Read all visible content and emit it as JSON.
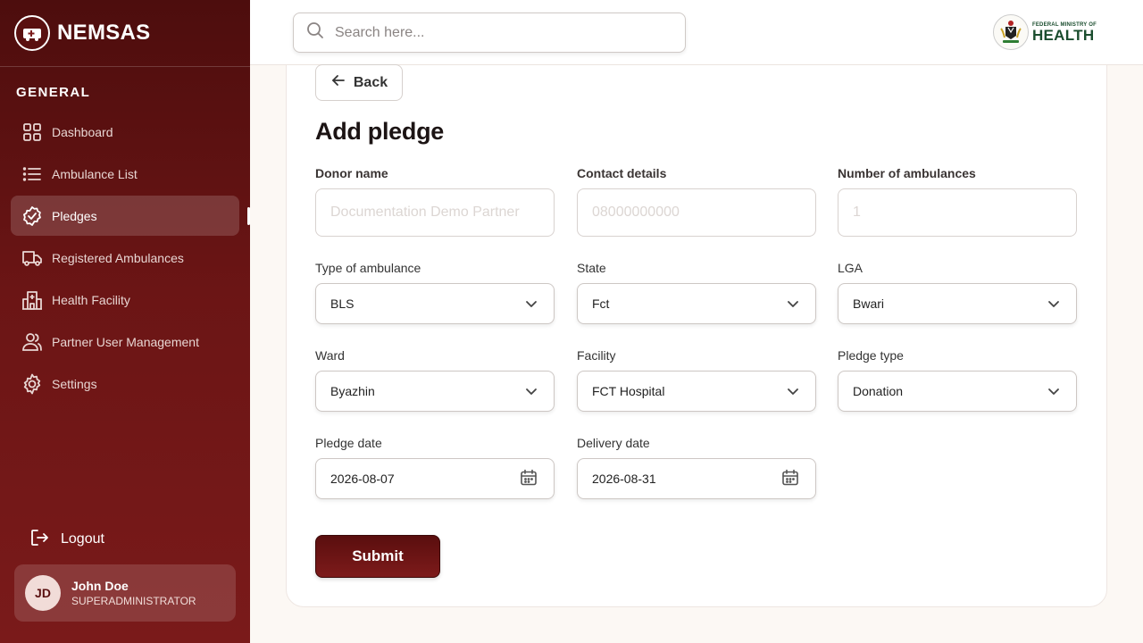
{
  "app": {
    "name": "NEMSAS",
    "logo_icon": "ambulance-logo-icon"
  },
  "sidebar": {
    "section_label": "GENERAL",
    "items": [
      {
        "label": "Dashboard",
        "icon": "grid-icon",
        "active": false
      },
      {
        "label": "Ambulance List",
        "icon": "list-icon",
        "active": false
      },
      {
        "label": "Pledges",
        "icon": "badge-check-icon",
        "active": true
      },
      {
        "label": "Registered Ambulances",
        "icon": "truck-icon",
        "active": false
      },
      {
        "label": "Health Facility",
        "icon": "hospital-icon",
        "active": false
      },
      {
        "label": "Partner User Management",
        "icon": "users-icon",
        "active": false
      },
      {
        "label": "Settings",
        "icon": "gear-icon",
        "active": false
      }
    ],
    "logout_label": "Logout",
    "user": {
      "initials": "JD",
      "name": "John Doe",
      "role": "SUPERADMINISTRATOR"
    }
  },
  "topbar": {
    "search_placeholder": "Search here...",
    "ministry_small": "FEDERAL MINISTRY OF",
    "ministry_big": "HEALTH"
  },
  "form": {
    "back_label": "Back",
    "title": "Add pledge",
    "donor_name": {
      "label": "Donor name",
      "placeholder": "Documentation Demo Partner",
      "value": ""
    },
    "contact_details": {
      "label": "Contact details",
      "placeholder": "08000000000",
      "value": ""
    },
    "number_of_ambulances": {
      "label": "Number of ambulances",
      "placeholder": "1",
      "value": ""
    },
    "type_of_ambulance": {
      "label": "Type of ambulance",
      "value": "BLS"
    },
    "state": {
      "label": "State",
      "value": "Fct"
    },
    "lga": {
      "label": "LGA",
      "value": "Bwari"
    },
    "ward": {
      "label": "Ward",
      "value": "Byazhin"
    },
    "facility": {
      "label": "Facility",
      "value": "FCT Hospital"
    },
    "pledge_type": {
      "label": "Pledge type",
      "value": "Donation"
    },
    "pledge_date": {
      "label": "Pledge date",
      "value": "2026-08-07"
    },
    "delivery_date": {
      "label": "Delivery date",
      "value": "2026-08-31"
    },
    "submit_label": "Submit"
  },
  "colors": {
    "sidebar_dark": "#4d0d0d",
    "sidebar_light": "#7a1a1a",
    "accent": "#6b1515",
    "ministry_green": "#1a4d2e"
  }
}
